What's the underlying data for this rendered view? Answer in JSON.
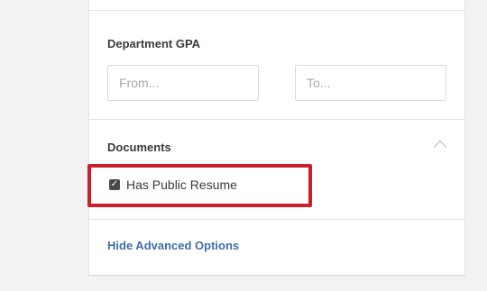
{
  "filters": {
    "department_gpa": {
      "label": "Department GPA",
      "from_placeholder": "From...",
      "to_placeholder": "To...",
      "from_value": "",
      "to_value": ""
    },
    "documents": {
      "label": "Documents",
      "toggle_icon": "chevron-up-icon",
      "has_public_resume": {
        "label": "Has Public Resume",
        "checked": true
      }
    },
    "hide_advanced_label": "Hide Advanced Options"
  },
  "colors": {
    "highlight": "#cc1f2d",
    "link": "#3d6fa8"
  }
}
